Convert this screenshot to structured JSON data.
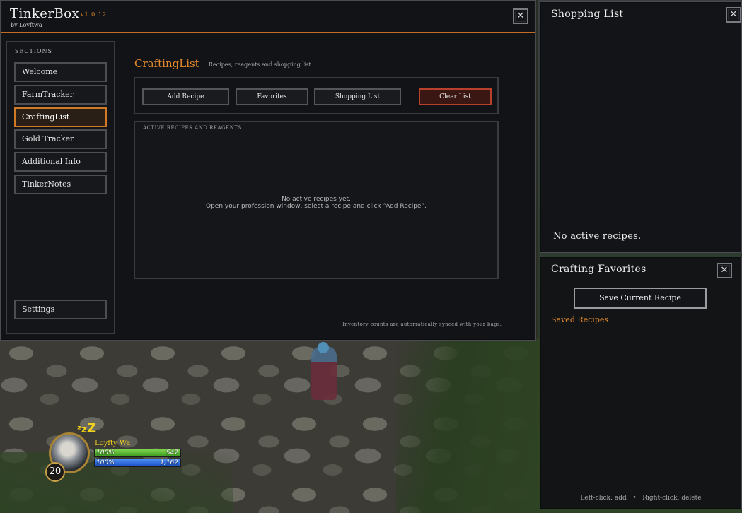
{
  "app": {
    "title": "TinkerBox",
    "version": "v1.0.12",
    "author": "by Loyftwa",
    "accent_color": "#e58a2d"
  },
  "sidebar": {
    "heading": "SECTIONS",
    "items": [
      {
        "label": "Welcome",
        "active": false
      },
      {
        "label": "FarmTracker",
        "active": false
      },
      {
        "label": "CraftingList",
        "active": true
      },
      {
        "label": "Gold Tracker",
        "active": false
      },
      {
        "label": "Additional Info",
        "active": false
      },
      {
        "label": "TinkerNotes",
        "active": false
      }
    ],
    "settings_label": "Settings"
  },
  "main": {
    "title": "CraftingList",
    "subtitle": "Recipes, reagents and shopping list",
    "toolbar": {
      "add_recipe": "Add Recipe",
      "favorites": "Favorites",
      "shopping_list": "Shopping List",
      "clear_list": "Clear List"
    },
    "recipes_panel": {
      "heading": "ACTIVE RECIPES AND REAGENTS",
      "empty_line1": "No active recipes yet.",
      "empty_line2": "Open your profession window, select a recipe and click “Add Recipe”."
    },
    "footnote": "Inventory counts are automatically synced with your bags.",
    "close_icon": "close-icon"
  },
  "shopping_list": {
    "title": "Shopping List",
    "empty_text": "No active recipes.",
    "close_icon": "close-icon"
  },
  "crafting_favorites": {
    "title": "Crafting Favorites",
    "save_button": "Save Current Recipe",
    "saved_heading": "Saved Recipes",
    "hint": "Left-click: add   •   Right-click: delete",
    "close_icon": "close-icon"
  },
  "unit_frame": {
    "name": "Loyfty Wa",
    "level": "20",
    "resting_icon": "zzz-icon",
    "health_pct": "100%",
    "health_value": "547",
    "mana_pct": "100%",
    "mana_value": "1,162",
    "health_color": "#5fbf36",
    "mana_color": "#2f6ee0"
  }
}
